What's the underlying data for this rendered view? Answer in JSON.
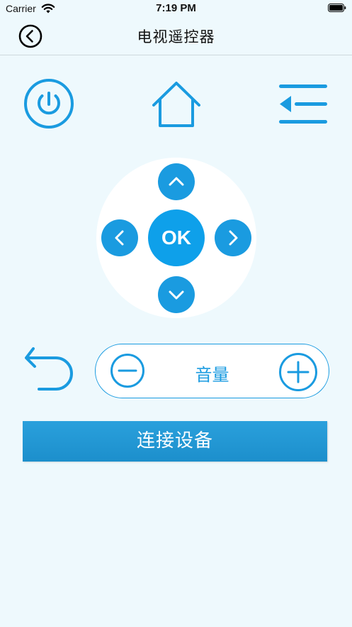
{
  "status_bar": {
    "carrier": "Carrier",
    "time": "7:19 PM"
  },
  "nav": {
    "title": "电视遥控器",
    "back_icon": "chevron-left-circle-icon"
  },
  "controls": {
    "power_icon": "power-icon",
    "home_icon": "home-icon",
    "menu_icon": "menu-icon",
    "return_icon": "return-arrow-icon"
  },
  "dpad": {
    "ok_label": "OK"
  },
  "volume": {
    "label": "音量",
    "minus_icon": "minus-circle-icon",
    "plus_icon": "plus-circle-icon"
  },
  "connect": {
    "label": "连接设备"
  },
  "colors": {
    "accent": "#1a9be0",
    "background": "#eef9fd"
  }
}
